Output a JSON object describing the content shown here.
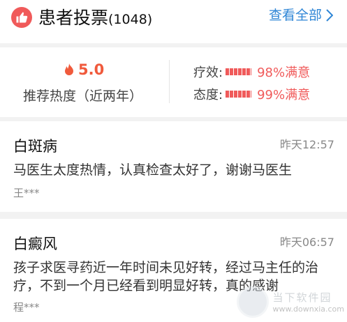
{
  "header": {
    "title": "患者投票",
    "count": "(1048)",
    "view_all": "查看全部",
    "icon": "thumbs-up-icon",
    "accent": "#f05a5a",
    "link_color": "#2f86d6"
  },
  "stats": {
    "score": "5.0",
    "score_icon": "flame-icon",
    "score_label": "推荐热度（近两年）",
    "ratings": [
      {
        "label": "疗效:",
        "value": "98%满意",
        "fill": 0.98
      },
      {
        "label": "态度:",
        "value": "99%满意",
        "fill": 0.99
      }
    ]
  },
  "reviews": [
    {
      "disease": "白斑病",
      "time": "昨天12:57",
      "content": "马医生太度热情，认真检查太好了，谢谢马医生",
      "author": "王***"
    },
    {
      "disease": "白癜风",
      "time": "昨天06:57",
      "content": "孩子求医寻药近一年时间未见好转，经过马主任的治疗，不到一个月已经看到明显好转，真的感谢",
      "author": "程***"
    }
  ],
  "watermark": {
    "cn": "当下软件园",
    "url": "www.downxia.com"
  }
}
